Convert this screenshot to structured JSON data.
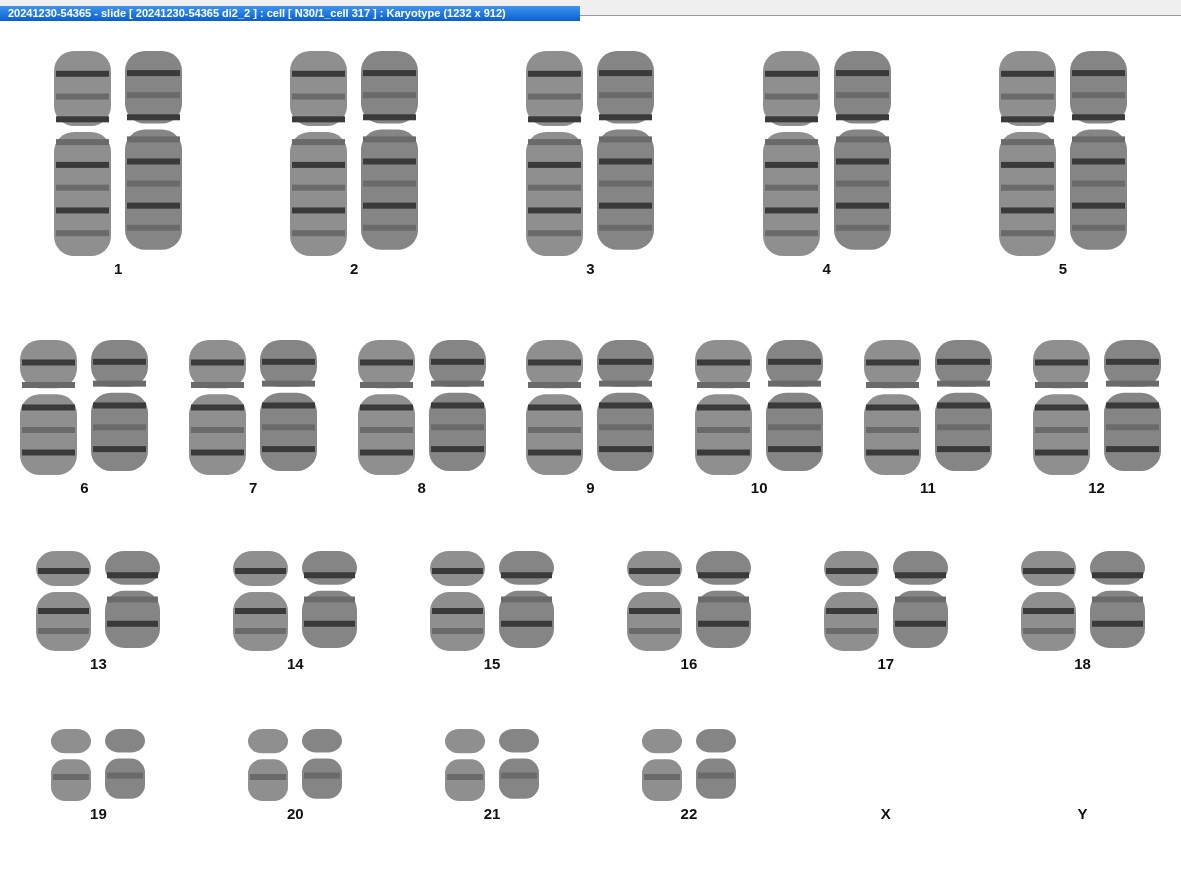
{
  "window": {
    "title": "20241230-54365 - slide [ 20241230-54365 di2_2 ] : cell [ N30/1_cell 317 ] : Karyotype  (1232 x 912)"
  },
  "rows": [
    {
      "pairs": [
        {
          "label": "1",
          "kind": "pair"
        },
        {
          "label": "2",
          "kind": "pair"
        },
        {
          "label": "3",
          "kind": "pair"
        },
        {
          "label": "4",
          "kind": "pair"
        },
        {
          "label": "5",
          "kind": "pair"
        }
      ]
    },
    {
      "pairs": [
        {
          "label": "6",
          "kind": "pair"
        },
        {
          "label": "7",
          "kind": "pair"
        },
        {
          "label": "8",
          "kind": "pair"
        },
        {
          "label": "9",
          "kind": "pair"
        },
        {
          "label": "10",
          "kind": "pair"
        },
        {
          "label": "11",
          "kind": "pair"
        },
        {
          "label": "12",
          "kind": "pair"
        }
      ]
    },
    {
      "pairs": [
        {
          "label": "13",
          "kind": "pair"
        },
        {
          "label": "14",
          "kind": "pair"
        },
        {
          "label": "15",
          "kind": "pair"
        },
        {
          "label": "16",
          "kind": "pair"
        },
        {
          "label": "17",
          "kind": "pair"
        },
        {
          "label": "18",
          "kind": "pair"
        }
      ]
    },
    {
      "pairs": [
        {
          "label": "19",
          "kind": "pair"
        },
        {
          "label": "20",
          "kind": "pair"
        },
        {
          "label": "21",
          "kind": "pair"
        },
        {
          "label": "22",
          "kind": "pair"
        },
        {
          "label": "X",
          "kind": "empty"
        },
        {
          "label": "Y",
          "kind": "empty"
        }
      ]
    }
  ]
}
